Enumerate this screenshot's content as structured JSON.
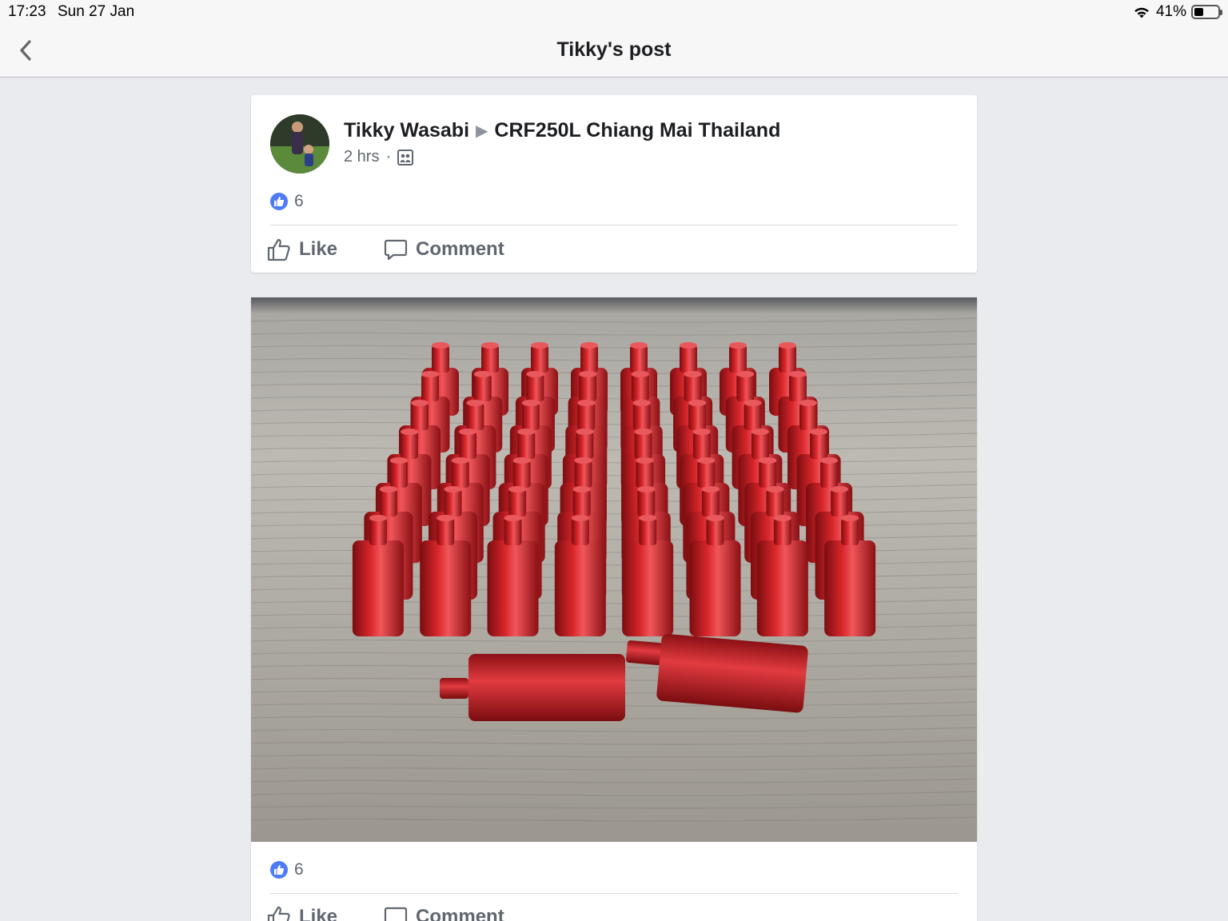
{
  "status_bar": {
    "time": "17:23",
    "date": "Sun 27 Jan",
    "battery": "41%",
    "battery_level": 0.41,
    "wifi_icon": "wifi-icon"
  },
  "nav": {
    "title": "Tikky's post",
    "back_icon": "chevron-left-icon"
  },
  "post": {
    "author": "Tikky Wasabi",
    "group": "CRF250L Chiang Mai Thailand",
    "time": "2 hrs",
    "separator": "·",
    "privacy_icon": "group-icon",
    "likes": "6",
    "like_label": "Like",
    "comment_label": "Comment"
  },
  "photo_post": {
    "likes": "6",
    "like_label": "Like",
    "comment_label": "Comment",
    "image_description": "red anodized cylindrical parts on wooden surface"
  },
  "colors": {
    "background": "#e9ebee",
    "like_blue": "#4e7cf6",
    "text_secondary": "#606770",
    "part_red": "#c0161c"
  }
}
